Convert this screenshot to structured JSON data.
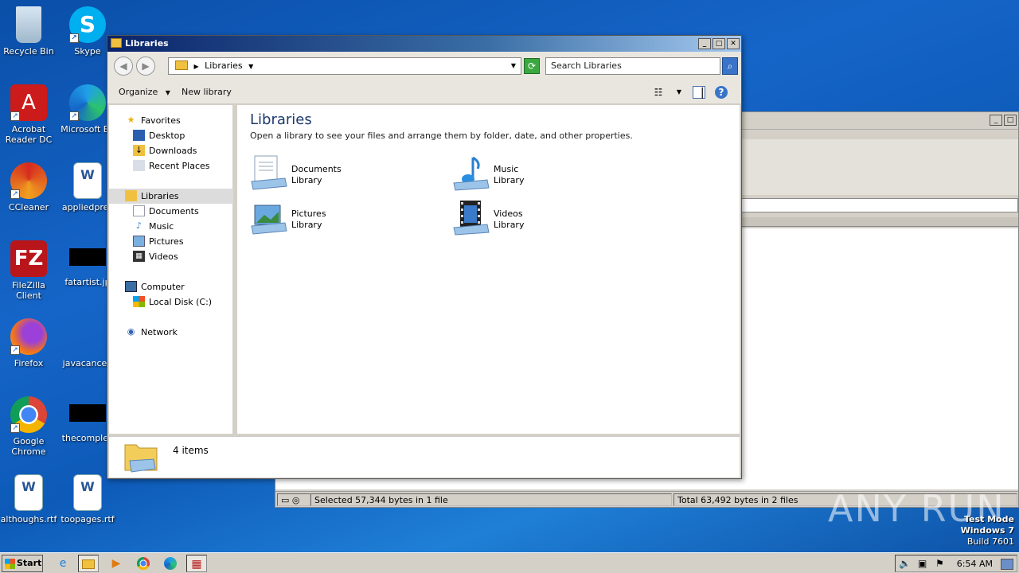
{
  "desktop": {
    "icons": [
      {
        "label": "Recycle Bin"
      },
      {
        "label": "Skype"
      },
      {
        "label": "Acrobat Reader DC"
      },
      {
        "label": "Microsoft Ed"
      },
      {
        "label": "CCleaner"
      },
      {
        "label": "appliedpres"
      },
      {
        "label": "FileZilla Client"
      },
      {
        "label": "fatartist.jp"
      },
      {
        "label": "Firefox"
      },
      {
        "label": "javacancer."
      },
      {
        "label": "Google Chrome"
      },
      {
        "label": "thecomplex"
      },
      {
        "label": "althoughs.rtf"
      },
      {
        "label": "toopages.rtf"
      }
    ]
  },
  "background_window": {
    "status_left": "Selected 57,344 bytes in 1 file",
    "status_right": "Total 63,492 bytes in 2 files"
  },
  "explorer": {
    "title": "Libraries",
    "address": "Libraries",
    "search_placeholder": "Search Libraries",
    "toolbar": {
      "organize": "Organize",
      "new_library": "New library"
    },
    "nav": {
      "favorites": "Favorites",
      "desktop": "Desktop",
      "downloads": "Downloads",
      "recent": "Recent Places",
      "libraries": "Libraries",
      "documents": "Documents",
      "music": "Music",
      "pictures": "Pictures",
      "videos": "Videos",
      "computer": "Computer",
      "local_disk": "Local Disk (C:)",
      "network": "Network"
    },
    "content": {
      "title": "Libraries",
      "description": "Open a library to see your files and arrange them by folder, date, and other properties.",
      "libraries": [
        {
          "name": "Documents",
          "type": "Library"
        },
        {
          "name": "Music",
          "type": "Library"
        },
        {
          "name": "Pictures",
          "type": "Library"
        },
        {
          "name": "Videos",
          "type": "Library"
        }
      ]
    },
    "details": {
      "count": "4 items"
    }
  },
  "taskbar": {
    "start": "Start",
    "clock": "6:54 AM"
  },
  "watermark": {
    "line1": "Test Mode",
    "line2": "Windows 7",
    "line3": "Build 7601",
    "brand": "ANY RUN"
  }
}
